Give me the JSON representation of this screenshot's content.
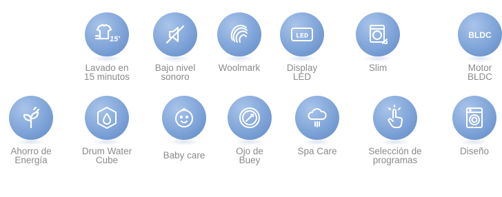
{
  "features": [
    {
      "id": "lavado-15",
      "lines": [
        "Lavado en",
        "15 minutos"
      ],
      "icon": "shirt-15-icon"
    },
    {
      "id": "bajo-nivel",
      "lines": [
        "Bajo nivel",
        "sonoro"
      ],
      "icon": "muted-speaker-icon"
    },
    {
      "id": "woolmark",
      "lines": [
        "Woolmark"
      ],
      "icon": "woolmark-icon"
    },
    {
      "id": "display-led",
      "lines": [
        "Display",
        "LED"
      ],
      "icon": "led-display-icon",
      "icon_text": "LED"
    },
    {
      "id": "slim",
      "lines": [
        "Slim"
      ],
      "icon": "slim-washer-icon"
    },
    {
      "id": "motor-bldc",
      "lines": [
        "Motor",
        "BLDC"
      ],
      "icon": "bldc-motor-icon",
      "icon_text": "BLDC"
    },
    {
      "id": "ahorro",
      "lines": [
        "Ahorro de",
        "Energía"
      ],
      "icon": "eco-plug-icon"
    },
    {
      "id": "drum-water",
      "lines": [
        "Drum Water",
        "Cube"
      ],
      "icon": "water-cube-icon"
    },
    {
      "id": "baby-care",
      "lines": [
        "Baby care"
      ],
      "icon": "baby-face-icon"
    },
    {
      "id": "ojo-buey",
      "lines": [
        "Ojo de",
        "Buey"
      ],
      "icon": "porthole-icon"
    },
    {
      "id": "spa-care",
      "lines": [
        "Spa Care"
      ],
      "icon": "steam-cloud-icon"
    },
    {
      "id": "seleccion",
      "lines": [
        "Selección de",
        "programas"
      ],
      "icon": "touch-hand-icon"
    },
    {
      "id": "diseno",
      "lines": [
        "Diseño"
      ],
      "icon": "washer-front-icon"
    }
  ],
  "colors": {
    "disc": "#7fa4d8",
    "label": "#8a8a8a",
    "icon": "#ffffff"
  }
}
